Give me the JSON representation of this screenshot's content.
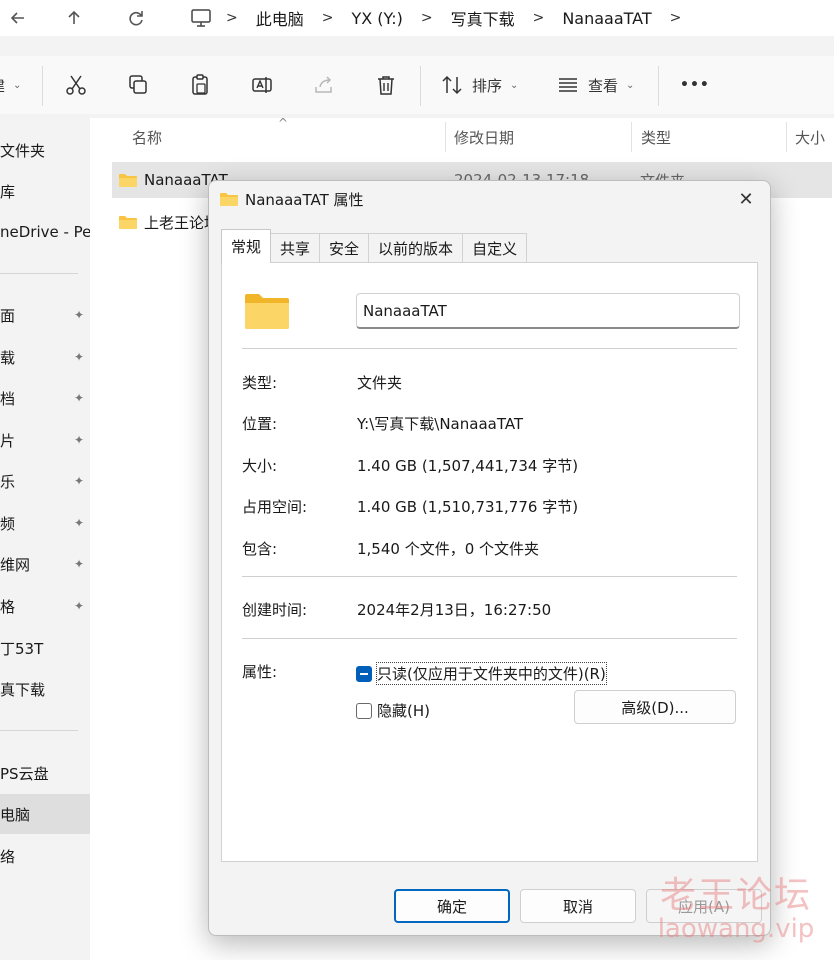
{
  "address_bar": {
    "back_icon": "back-arrow-icon",
    "up_icon": "up-arrow-icon",
    "refresh_icon": "refresh-icon",
    "breadcrumbs": [
      "此电脑",
      "YX (Y:)",
      "写真下载",
      "NanaaaTAT"
    ]
  },
  "toolbar": {
    "new_label": "建",
    "sort_label": "排序",
    "view_label": "查看",
    "more_label": "•••"
  },
  "sidebar": {
    "items": [
      {
        "label": "文件夹"
      },
      {
        "label": "库"
      },
      {
        "label": "neDrive - Pe"
      },
      {
        "label": "面"
      },
      {
        "label": "载"
      },
      {
        "label": "档"
      },
      {
        "label": "片"
      },
      {
        "label": "乐"
      },
      {
        "label": "频"
      },
      {
        "label": "维网"
      },
      {
        "label": "格"
      },
      {
        "label": "丁53T"
      },
      {
        "label": "真下载"
      },
      {
        "label": "PS云盘"
      },
      {
        "label": "电脑"
      },
      {
        "label": "络"
      }
    ],
    "pin_glyph": "📌"
  },
  "file_list": {
    "columns": [
      "名称",
      "修改日期",
      "类型",
      "大小"
    ],
    "sort_caret": "^",
    "rows": [
      {
        "name": "NanaaaTAT",
        "date": "2024-02-13 17:18",
        "type": "文件夹"
      },
      {
        "name": "上老王论坛"
      }
    ]
  },
  "dialog": {
    "title": "NanaaaTAT 属性",
    "close_glyph": "✕",
    "tabs": [
      "常规",
      "共享",
      "安全",
      "以前的版本",
      "自定义"
    ],
    "active_tab": "常规",
    "name_value": "NanaaaTAT",
    "properties": {
      "type_label": "类型:",
      "type_value": "文件夹",
      "location_label": "位置:",
      "location_value": "Y:\\写真下载\\NanaaaTAT",
      "size_label": "大小:",
      "size_value": "1.40 GB (1,507,441,734 字节)",
      "disk_label": "占用空间:",
      "disk_value": "1.40 GB (1,510,731,776 字节)",
      "contains_label": "包含:",
      "contains_value": "1,540 个文件，0 个文件夹",
      "created_label": "创建时间:",
      "created_value": "2024年2月13日，16:27:50",
      "attributes_label": "属性:"
    },
    "readonly_label": "只读(仅应用于文件夹中的文件)(R)",
    "hidden_label": "隐藏(H)",
    "advanced_label": "高级(D)...",
    "ok_label": "确定",
    "cancel_label": "取消",
    "apply_label": "应用(A)"
  },
  "watermark": {
    "cn": "老王论坛",
    "en": "laowang.vip"
  },
  "colors": {
    "accent": "#005fb8",
    "folder_yellow": "#f8c542",
    "watermark": "#e67878"
  }
}
